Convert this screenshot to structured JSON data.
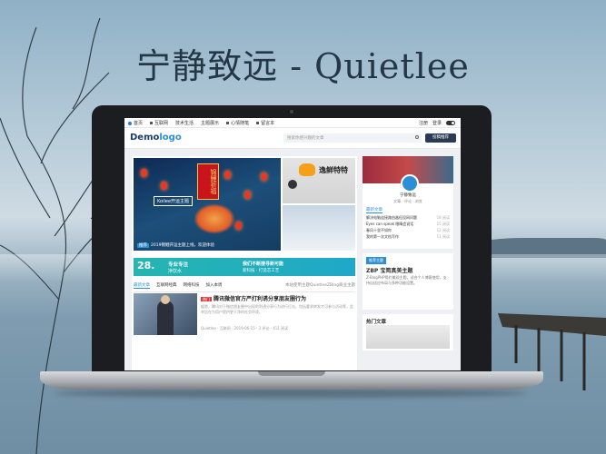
{
  "headline": "宁静致远 - Quietlee",
  "site": {
    "nav": {
      "home": "首页",
      "items": [
        "互联网",
        "技术生活",
        "主题展示",
        "心情随笔",
        "留言本"
      ]
    },
    "topright": {
      "register": "注册",
      "login": "登录"
    },
    "logo_part1": "Demo",
    "logo_part2": "logo",
    "search_placeholder": "搜索你感兴趣的文章",
    "post_button": "投稿推荐",
    "banner": {
      "title": "Koilee开运主题",
      "sign": "锦鲤祈福",
      "caption_tag": "推荐",
      "caption": "2019锦鲤开运主题上线，欢迎体验"
    },
    "thumb1_text": "逸鲜特特",
    "ad": {
      "number": "28.",
      "line1": "专业专注",
      "line2": "净饮水",
      "line3": "我们不断搜寻新可能",
      "line4": "新科技 · 打造芯工艺"
    },
    "tabs": [
      "最新文章",
      "互联网经典",
      "网络科技",
      "加入本周"
    ],
    "notice": "本站使用主题QuietleeZBlog商业主题",
    "article": {
      "tag": "热门",
      "title": "腾讯微信官方严打利诱分享朋友圈行为",
      "desc": "据悉，腾讯对于微信朋友圈中出现的利诱分享行为进行打击，包括要求转发才可参与活动等，此举旨在为用户提供更干净的社交环境。",
      "author": "Quietlee",
      "category": "互联网",
      "date": "2019-06-15",
      "comments": "3 评论",
      "views": "411 阅读"
    },
    "profile": {
      "name": "宁静致远",
      "stats": "文章 · 评论 · 浏览",
      "label": "最新文章",
      "list": [
        {
          "text": "解决电脑连接路由器但没网问题",
          "count": "18 阅读"
        },
        {
          "text": "Eyes can speak 眼睛会说话",
          "count": "15 阅读"
        },
        {
          "text": "春风十里不如你",
          "count": "12 阅读"
        },
        {
          "text": "我的第一次文档写作",
          "count": "11 阅读"
        }
      ]
    },
    "zbp": {
      "tag": "推荐主题",
      "title": "ZBP 宝简真美主题",
      "desc": "Z-BlogPHP简约美观主题，适合个人博客使用，支持自适应布局与多种功能设置。"
    },
    "hot_title": "热门文章"
  },
  "colors": {
    "accent": "#2b8fd6",
    "navy": "#2b3a55",
    "ad_teal": "#25b6b0"
  }
}
